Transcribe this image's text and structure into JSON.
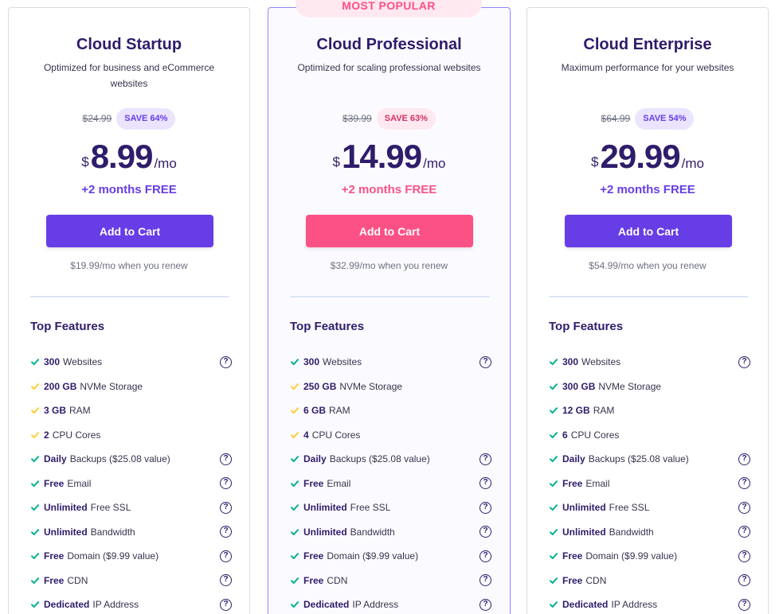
{
  "colors": {
    "primary": "#673de6",
    "popular_accent": "#fc5185",
    "check_green": "#00b090",
    "check_yellow": "#ffcd35",
    "text_dark": "#2f1c6a"
  },
  "plans": [
    {
      "name": "Cloud Startup",
      "description": "Optimized for business and eCommerce websites",
      "old_price": "$24.99",
      "save": "SAVE 64%",
      "currency": "$",
      "price": "8.99",
      "period": "/mo",
      "bonus": "+2 months FREE",
      "cta": "Add to Cart",
      "renew": "$19.99/mo when you renew",
      "features_title": "Top Features",
      "features": [
        {
          "bold": "300",
          "text": "Websites",
          "check": "green",
          "help": true
        },
        {
          "bold": "200 GB",
          "text": "NVMe Storage",
          "check": "yellow",
          "help": false
        },
        {
          "bold": "3 GB",
          "text": "RAM",
          "check": "yellow",
          "help": false
        },
        {
          "bold": "2",
          "text": "CPU Cores",
          "check": "yellow",
          "help": false
        },
        {
          "bold": "Daily",
          "text": "Backups ($25.08 value)",
          "check": "green",
          "help": true
        },
        {
          "bold": "Free",
          "text": "Email",
          "check": "green",
          "help": true
        },
        {
          "bold": "Unlimited",
          "text": "Free SSL",
          "check": "green",
          "help": true
        },
        {
          "bold": "Unlimited",
          "text": "Bandwidth",
          "check": "green",
          "help": true
        },
        {
          "bold": "Free",
          "text": "Domain ($9.99 value)",
          "check": "green",
          "help": true
        },
        {
          "bold": "Free",
          "text": "CDN",
          "check": "green",
          "help": true
        },
        {
          "bold": "Dedicated",
          "text": "IP Address",
          "check": "green",
          "help": true
        }
      ]
    },
    {
      "ribbon": "MOST POPULAR",
      "name": "Cloud Professional",
      "description": "Optimized for scaling professional websites",
      "old_price": "$39.99",
      "save": "SAVE 63%",
      "currency": "$",
      "price": "14.99",
      "period": "/mo",
      "bonus": "+2 months FREE",
      "cta": "Add to Cart",
      "renew": "$32.99/mo when you renew",
      "features_title": "Top Features",
      "features": [
        {
          "bold": "300",
          "text": "Websites",
          "check": "green",
          "help": true
        },
        {
          "bold": "250 GB",
          "text": "NVMe Storage",
          "check": "yellow",
          "help": false
        },
        {
          "bold": "6 GB",
          "text": "RAM",
          "check": "yellow",
          "help": false
        },
        {
          "bold": "4",
          "text": "CPU Cores",
          "check": "yellow",
          "help": false
        },
        {
          "bold": "Daily",
          "text": "Backups ($25.08 value)",
          "check": "green",
          "help": true
        },
        {
          "bold": "Free",
          "text": "Email",
          "check": "green",
          "help": true
        },
        {
          "bold": "Unlimited",
          "text": "Free SSL",
          "check": "green",
          "help": true
        },
        {
          "bold": "Unlimited",
          "text": "Bandwidth",
          "check": "green",
          "help": true
        },
        {
          "bold": "Free",
          "text": "Domain ($9.99 value)",
          "check": "green",
          "help": true
        },
        {
          "bold": "Free",
          "text": "CDN",
          "check": "green",
          "help": true
        },
        {
          "bold": "Dedicated",
          "text": "IP Address",
          "check": "green",
          "help": true
        }
      ]
    },
    {
      "name": "Cloud Enterprise",
      "description": "Maximum performance for your websites",
      "old_price": "$64.99",
      "save": "SAVE 54%",
      "currency": "$",
      "price": "29.99",
      "period": "/mo",
      "bonus": "+2 months FREE",
      "cta": "Add to Cart",
      "renew": "$54.99/mo when you renew",
      "features_title": "Top Features",
      "features": [
        {
          "bold": "300",
          "text": "Websites",
          "check": "green",
          "help": true
        },
        {
          "bold": "300 GB",
          "text": "NVMe Storage",
          "check": "green",
          "help": false
        },
        {
          "bold": "12 GB",
          "text": "RAM",
          "check": "green",
          "help": false
        },
        {
          "bold": "6",
          "text": "CPU Cores",
          "check": "green",
          "help": false
        },
        {
          "bold": "Daily",
          "text": "Backups ($25.08 value)",
          "check": "green",
          "help": true
        },
        {
          "bold": "Free",
          "text": "Email",
          "check": "green",
          "help": true
        },
        {
          "bold": "Unlimited",
          "text": "Free SSL",
          "check": "green",
          "help": true
        },
        {
          "bold": "Unlimited",
          "text": "Bandwidth",
          "check": "green",
          "help": true
        },
        {
          "bold": "Free",
          "text": "Domain ($9.99 value)",
          "check": "green",
          "help": true
        },
        {
          "bold": "Free",
          "text": "CDN",
          "check": "green",
          "help": true
        },
        {
          "bold": "Dedicated",
          "text": "IP Address",
          "check": "green",
          "help": true
        }
      ]
    }
  ],
  "help_glyph": "?"
}
